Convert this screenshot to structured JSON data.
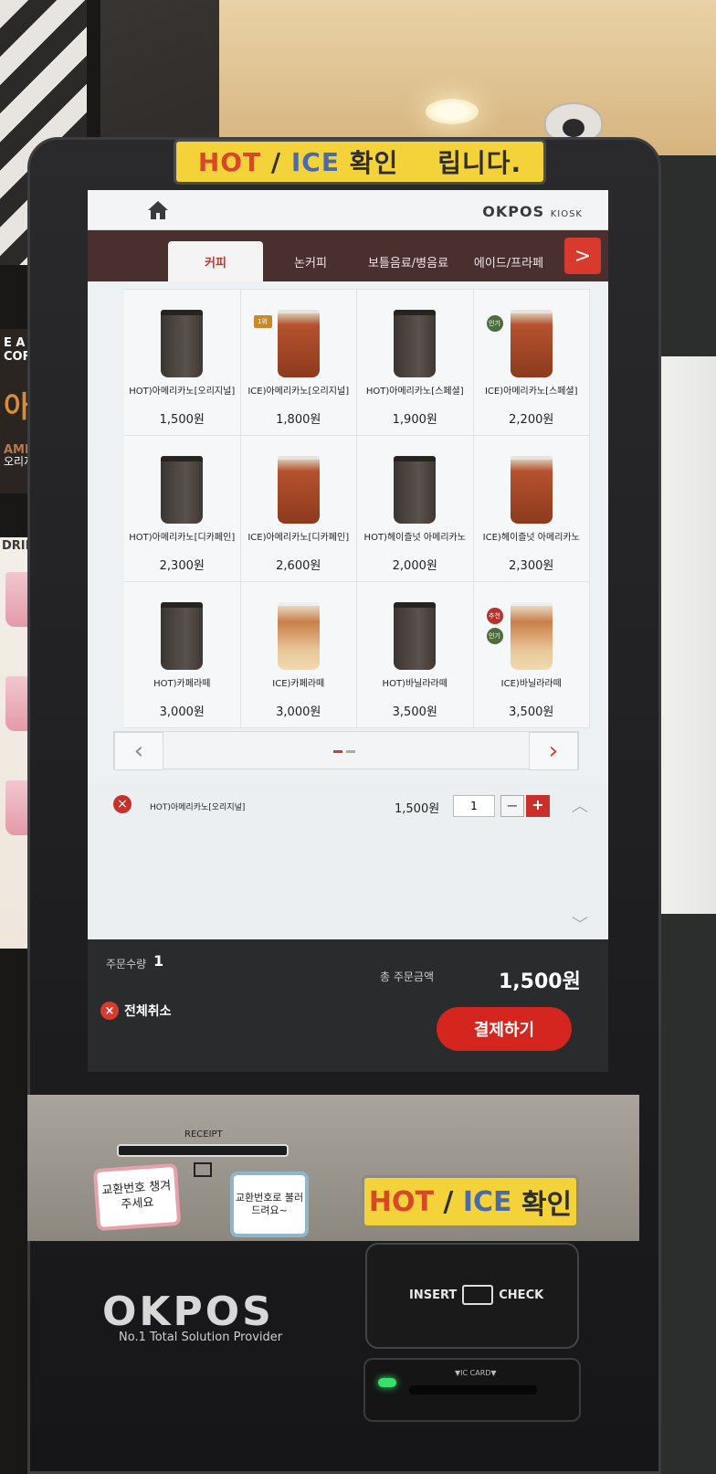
{
  "top_sticker": {
    "hot": "HOT",
    "slash": "/",
    "ice": "ICE",
    "check": "확인",
    "trail": "립니다."
  },
  "header": {
    "brand": "OKPOS",
    "brand_sub": "KIOSK"
  },
  "tabs": [
    {
      "label": "커피",
      "active": true
    },
    {
      "label": "논커피",
      "active": false
    },
    {
      "label": "보틀음료/병음료",
      "active": false
    },
    {
      "label": "에이드/프라페",
      "active": false
    }
  ],
  "tab_next_label": ">",
  "menu_items": [
    {
      "name": "HOT)아메리카노[오리지널]",
      "price": "1,500원",
      "cup": "hot",
      "badge": ""
    },
    {
      "name": "ICE)아메리카노[오리지널]",
      "price": "1,800원",
      "cup": "ice",
      "badge": "1위"
    },
    {
      "name": "HOT)아메리카노[스페셜]",
      "price": "1,900원",
      "cup": "hot",
      "badge": ""
    },
    {
      "name": "ICE)아메리카노[스페셜]",
      "price": "2,200원",
      "cup": "ice",
      "badge": "인기"
    },
    {
      "name": "HOT)아메리카노[디카페인]",
      "price": "2,300원",
      "cup": "hot",
      "badge": ""
    },
    {
      "name": "ICE)아메리카노[디카페인]",
      "price": "2,600원",
      "cup": "ice",
      "badge": ""
    },
    {
      "name": "HOT)헤이즐넛 아메리카노",
      "price": "2,000원",
      "cup": "hot",
      "badge": ""
    },
    {
      "name": "ICE)헤이즐넛 아메리카노",
      "price": "2,300원",
      "cup": "ice",
      "badge": ""
    },
    {
      "name": "HOT)카페라떼",
      "price": "3,000원",
      "cup": "hot",
      "badge": ""
    },
    {
      "name": "ICE)카페라떼",
      "price": "3,000원",
      "cup": "latte",
      "badge": ""
    },
    {
      "name": "HOT)바닐라라떼",
      "price": "3,500원",
      "cup": "hot",
      "badge": ""
    },
    {
      "name": "ICE)바닐라라떼",
      "price": "3,500원",
      "cup": "latte",
      "badge": "추천 인기"
    }
  ],
  "pager": {
    "prev": "‹",
    "next": "›"
  },
  "cart": {
    "item_name": "HOT)아메리카노[오리지널]",
    "item_price": "1,500원",
    "quantity": "1",
    "minus": "−",
    "plus": "+"
  },
  "summary": {
    "qty_label": "주문수량",
    "qty_value": "1",
    "total_label": "총 주문금액",
    "total_value": "1,500원",
    "cancel_all": "전체취소",
    "pay_button": "결제하기"
  },
  "hardware": {
    "receipt_label": "RECEIPT",
    "note1": "교환번호 챙겨주세요",
    "note2": "교환번호로 불러드려요~",
    "bottom_sticker_hot": "HOT",
    "bottom_sticker_slash": "/",
    "bottom_sticker_ice": "ICE",
    "bottom_sticker_check": "확인",
    "logo": "OKPOS",
    "tagline": "No.1 Total Solution Provider",
    "insert_left": "INSERT",
    "insert_right": "CHECK",
    "ic_card": "▼IC CARD▼"
  },
  "environment": {
    "poster_line": "E A COFFEE",
    "poster_big": "아메리",
    "poster_sub": "AMERIC",
    "poster_badge": "오리지널",
    "drinks_title": "DRINKS"
  }
}
